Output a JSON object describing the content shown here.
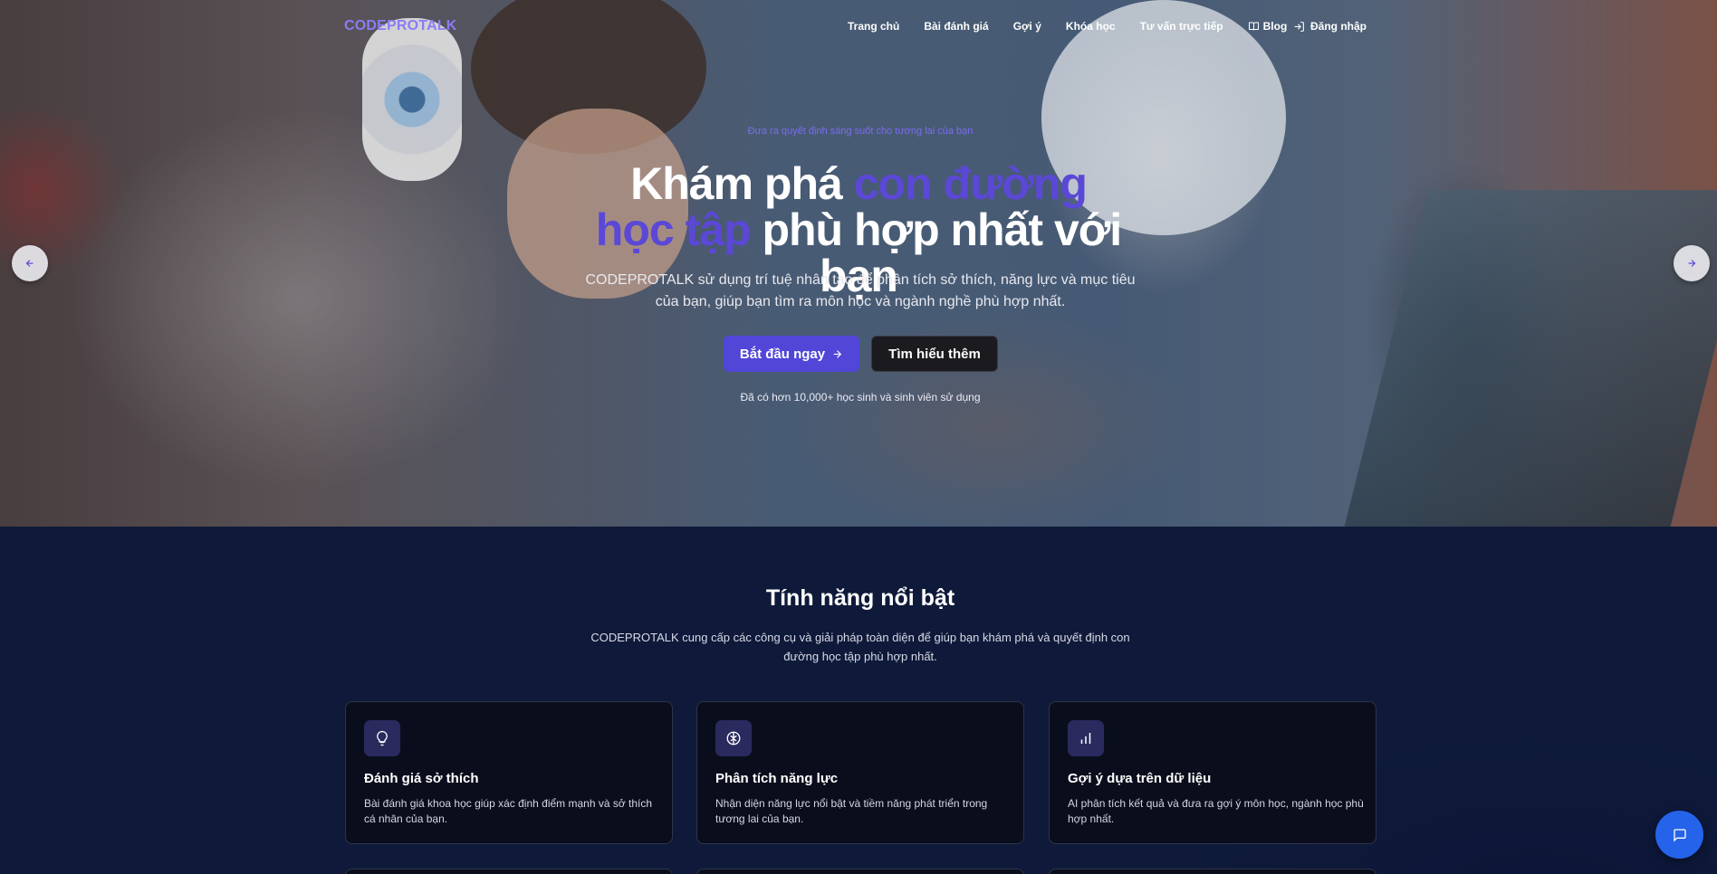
{
  "brand": {
    "logo": "CODEPROTALK",
    "accent": "#8b7cf6"
  },
  "nav": {
    "links": [
      {
        "label": "Trang chủ"
      },
      {
        "label": "Bài đánh giá"
      },
      {
        "label": "Gợi ý"
      },
      {
        "label": "Khóa học"
      },
      {
        "label": "Tư vấn trực tiếp"
      },
      {
        "label": "Blog",
        "icon": "book-icon"
      }
    ],
    "login": {
      "label": "Đăng nhập",
      "icon": "login-icon"
    }
  },
  "hero": {
    "tagline": "Đưa ra quyết định sáng suốt cho tương lai của bạn",
    "headline_part1": "Khám phá ",
    "headline_accent": "con đường học tập",
    "headline_part2": " phù hợp nhất với bạn",
    "subtitle": "CODEPROTALK sử dụng trí tuệ nhân tạo để phân tích sở thích, năng lực và mục tiêu của bạn, giúp bạn tìm ra môn học và ngành nghề phù hợp nhất.",
    "primary_button": "Bắt đầu ngay",
    "secondary_button": "Tìm hiểu thêm",
    "users_note": "Đã có hơn 10,000+ học sinh và sinh viên sử dụng",
    "accent_color": "#5b48d6",
    "primary_color": "#5146d8"
  },
  "features": {
    "title": "Tính năng nổi bật",
    "description": "CODEPROTALK cung cấp các công cụ và giải pháp toàn diện để giúp bạn khám phá và quyết định con đường học tập phù hợp nhất.",
    "cards": [
      {
        "icon": "lightbulb-icon",
        "title": "Đánh giá sở thích",
        "desc": "Bài đánh giá khoa học giúp xác định điểm mạnh và sở thích cá nhân của bạn."
      },
      {
        "icon": "brain-icon",
        "title": "Phân tích năng lực",
        "desc": "Nhận diện năng lực nổi bật và tiềm năng phát triển trong tương lai của bạn."
      },
      {
        "icon": "bar-chart-icon",
        "title": "Gợi ý dựa trên dữ liệu",
        "desc": "AI phân tích kết quả và đưa ra gợi ý môn học, ngành học phù hợp nhất."
      }
    ]
  },
  "carousel": {
    "prev_icon": "arrow-left-icon",
    "next_icon": "arrow-right-icon"
  },
  "chat": {
    "icon": "chat-icon",
    "color": "#2563eb"
  }
}
